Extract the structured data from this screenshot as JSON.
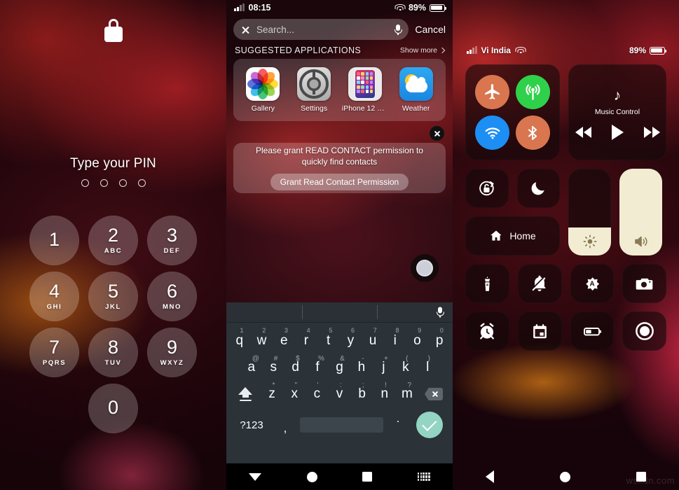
{
  "lock_screen": {
    "lock_icon": "lock-icon",
    "prompt": "Type your PIN",
    "pin_dots": 4,
    "keys": [
      {
        "num": "1",
        "letters": ""
      },
      {
        "num": "2",
        "letters": "ABC"
      },
      {
        "num": "3",
        "letters": "DEF"
      },
      {
        "num": "4",
        "letters": "GHI"
      },
      {
        "num": "5",
        "letters": "JKL"
      },
      {
        "num": "6",
        "letters": "MNO"
      },
      {
        "num": "7",
        "letters": "PQRS"
      },
      {
        "num": "8",
        "letters": "TUV"
      },
      {
        "num": "9",
        "letters": "WXYZ"
      },
      {
        "num": "0",
        "letters": ""
      }
    ]
  },
  "search_screen": {
    "status": {
      "time": "08:15",
      "battery_percent": "89%",
      "battery_level": 89
    },
    "search": {
      "placeholder": "Search...",
      "value": "",
      "cancel_label": "Cancel"
    },
    "section": {
      "title": "SUGGESTED APPLICATIONS",
      "show_more_label": "Show more"
    },
    "apps": [
      {
        "name": "Gallery",
        "icon": "gallery-icon"
      },
      {
        "name": "Settings",
        "icon": "settings-gear-icon"
      },
      {
        "name": "iPhone 12 Setti...",
        "icon": "iphone-12-settings-icon"
      },
      {
        "name": "Weather",
        "icon": "weather-icon"
      }
    ],
    "permission": {
      "message": "Please grant READ CONTACT permission to quickly find contacts",
      "button_label": "Grant Read Contact Permission"
    },
    "keyboard": {
      "row1": [
        {
          "key": "q",
          "sup": "1"
        },
        {
          "key": "w",
          "sup": "2"
        },
        {
          "key": "e",
          "sup": "3"
        },
        {
          "key": "r",
          "sup": "4"
        },
        {
          "key": "t",
          "sup": "5"
        },
        {
          "key": "y",
          "sup": "6"
        },
        {
          "key": "u",
          "sup": "7"
        },
        {
          "key": "i",
          "sup": "8"
        },
        {
          "key": "o",
          "sup": "9"
        },
        {
          "key": "p",
          "sup": "0"
        }
      ],
      "row2": [
        {
          "key": "a",
          "sup": "@"
        },
        {
          "key": "s",
          "sup": "#"
        },
        {
          "key": "d",
          "sup": "$"
        },
        {
          "key": "f",
          "sup": "%"
        },
        {
          "key": "g",
          "sup": "&"
        },
        {
          "key": "h",
          "sup": "-"
        },
        {
          "key": "j",
          "sup": "+"
        },
        {
          "key": "k",
          "sup": "("
        },
        {
          "key": "l",
          "sup": ")"
        }
      ],
      "row3": [
        {
          "key": "z",
          "sup": "*"
        },
        {
          "key": "x",
          "sup": "\""
        },
        {
          "key": "c",
          "sup": "'"
        },
        {
          "key": "v",
          "sup": ":"
        },
        {
          "key": "b",
          "sup": ";"
        },
        {
          "key": "n",
          "sup": "!"
        },
        {
          "key": "m",
          "sup": "?"
        }
      ],
      "symbols_label": "?123",
      "comma_label": ",",
      "period_label": ".",
      "space_label": ""
    },
    "navbar": [
      "back-triangle-icon",
      "home-circle-icon",
      "recents-square-icon",
      "keyboard-icon"
    ]
  },
  "control_center": {
    "status": {
      "carrier": "Vi India",
      "battery_percent": "89%",
      "battery_level": 89
    },
    "connectivity": [
      {
        "name": "airplane-mode-icon",
        "color": "#d9764f"
      },
      {
        "name": "cellular-data-icon",
        "color": "#2fd14a"
      },
      {
        "name": "wifi-icon",
        "color": "#1c8ef4"
      },
      {
        "name": "bluetooth-icon",
        "color": "#d9764f"
      }
    ],
    "music": {
      "title": "Music Control",
      "note_glyph": "♪",
      "controls": [
        "rewind-icon",
        "play-icon",
        "fast-forward-icon"
      ]
    },
    "toggles": [
      {
        "name": "rotation-lock-icon"
      },
      {
        "name": "do-not-disturb-moon-icon"
      }
    ],
    "home_tile": {
      "label": "Home",
      "icon": "home-icon"
    },
    "brightness": {
      "icon": "brightness-sun-icon",
      "value": 32
    },
    "volume": {
      "icon": "volume-icon",
      "value": 100
    },
    "shortcuts": [
      {
        "name": "flashlight-icon"
      },
      {
        "name": "mute-bell-off-icon"
      },
      {
        "name": "auto-brightness-icon"
      },
      {
        "name": "camera-icon"
      },
      {
        "name": "alarm-clock-icon"
      },
      {
        "name": "calendar-icon"
      },
      {
        "name": "low-power-battery-icon"
      },
      {
        "name": "screen-record-icon"
      }
    ],
    "navbar": [
      "back-arrow-icon",
      "home-circle-icon",
      "recents-square-icon"
    ]
  },
  "watermark": "wsxdn.com"
}
